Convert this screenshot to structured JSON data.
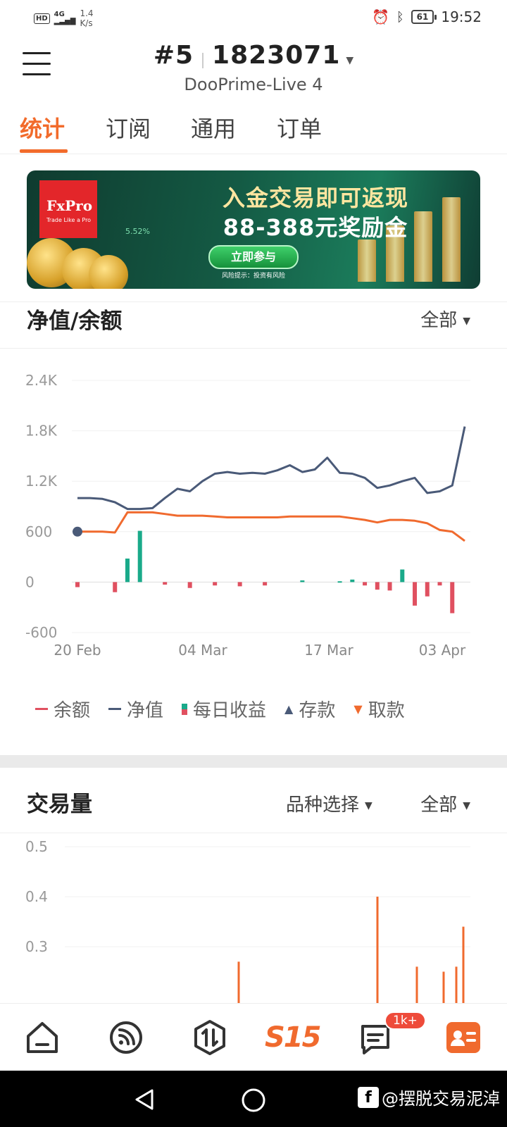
{
  "status_bar": {
    "hd": "HD",
    "network": "4G",
    "speed_value": "1.4",
    "speed_unit": "K/s",
    "battery": "61",
    "time": "19:52"
  },
  "header": {
    "account_index": "#5",
    "account_number": "1823071",
    "server": "DooPrime-Live 4"
  },
  "tabs": [
    {
      "label": "统计",
      "active": true
    },
    {
      "label": "订阅",
      "active": false
    },
    {
      "label": "通用",
      "active": false
    },
    {
      "label": "订单",
      "active": false
    }
  ],
  "banner": {
    "brand": "FxPro",
    "brand_tagline": "Trade Like a Pro",
    "headline_1": "入金交易即可返现",
    "headline_2": "88-388元奖励金",
    "pct": "5.52%",
    "cta": "立即参与",
    "risk_note": "风险提示：投资有风险"
  },
  "equity_section": {
    "title": "净值/余额",
    "filter": "全部",
    "legend": [
      "余额",
      "净值",
      "每日收益",
      "存款",
      "取款"
    ],
    "colors": {
      "balance": "#f06a2e",
      "equity": "#4a5a78",
      "profit_pos": "#1aaa8a",
      "loss_neg": "#e05060",
      "deposit": "#4a5a78",
      "withdraw": "#f06a2e"
    }
  },
  "chart_data": [
    {
      "type": "line",
      "y_ticks": [
        "2.4K",
        "1.8K",
        "1.2K",
        "600",
        "0",
        "-600"
      ],
      "x_ticks": [
        "20 Feb",
        "04 Mar",
        "17 Mar",
        "03 Apr"
      ],
      "ylim": [
        -600,
        2400
      ],
      "series": [
        {
          "name": "净值",
          "values": [
            1000,
            1000,
            990,
            950,
            870,
            870,
            880,
            1000,
            1110,
            1080,
            1200,
            1290,
            1310,
            1290,
            1300,
            1290,
            1330,
            1390,
            1310,
            1340,
            1480,
            1300,
            1290,
            1240,
            1120,
            1150,
            1200,
            1240,
            1060,
            1080,
            1150,
            1850
          ]
        },
        {
          "name": "余额",
          "values": [
            600,
            600,
            600,
            590,
            830,
            830,
            830,
            810,
            790,
            790,
            790,
            780,
            770,
            770,
            770,
            770,
            770,
            780,
            780,
            780,
            780,
            780,
            760,
            740,
            710,
            740,
            740,
            730,
            700,
            620,
            600,
            490
          ]
        },
        {
          "name": "每日收益",
          "values": [
            -60,
            0,
            0,
            -120,
            280,
            610,
            0,
            -30,
            0,
            -70,
            0,
            -40,
            0,
            -50,
            0,
            -40,
            0,
            0,
            20,
            0,
            0,
            10,
            30,
            -40,
            -90,
            -100,
            150,
            -280,
            -170,
            -40,
            -370,
            0
          ]
        }
      ]
    },
    {
      "type": "bar",
      "y_ticks": [
        "0.5",
        "0.4",
        "0.3"
      ],
      "values": [
        0.27,
        0.4,
        0.26,
        0.25,
        0.26,
        0.34
      ]
    }
  ],
  "volume_section": {
    "title": "交易量",
    "product_select": "品种选择",
    "filter": "全部"
  },
  "bottom_nav": {
    "items": [
      "home-icon",
      "feed-icon",
      "trade-icon",
      "s15-icon",
      "message-icon",
      "profile-icon"
    ],
    "s15_label": "S15",
    "badge": "1k+"
  },
  "watermark": "@摆脱交易泥淖"
}
